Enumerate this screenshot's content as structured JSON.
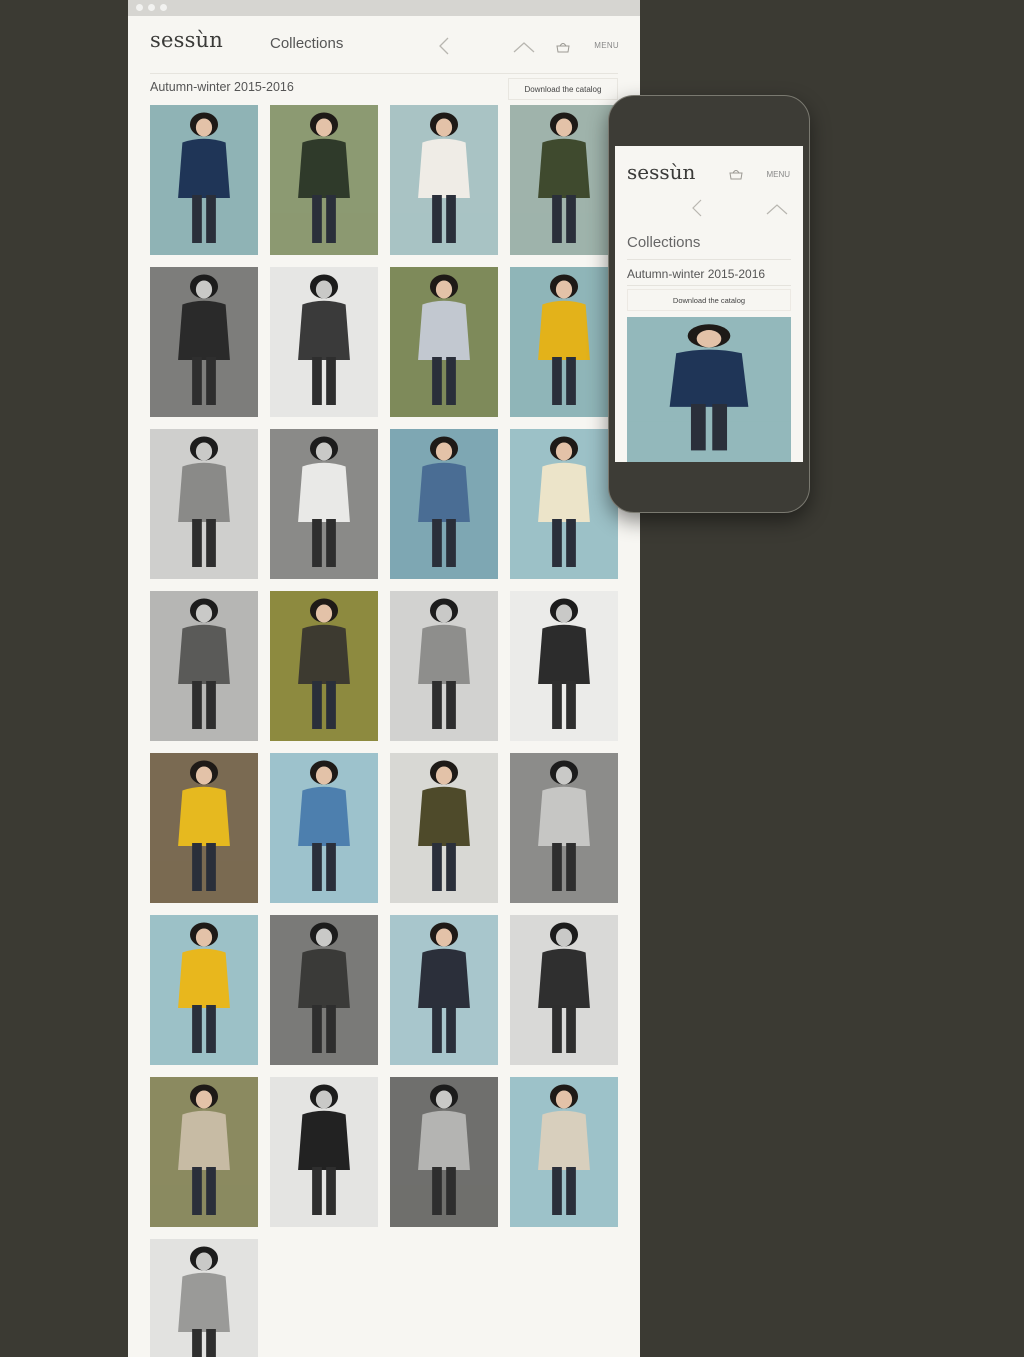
{
  "brand": "sessùn",
  "nav": {
    "title": "Collections",
    "menu_label": "MENU"
  },
  "collection": {
    "season": "Autumn-winter 2015-2016",
    "download_label": "Download the catalog"
  },
  "mobile": {
    "brand": "sessùn",
    "menu_label": "MENU",
    "title": "Collections",
    "season": "Autumn-winter 2015-2016",
    "download_label": "Download the catalog"
  },
  "photos": [
    {
      "bg": "#8fb3b5",
      "coat": "#1f3557",
      "tone": "color"
    },
    {
      "bg": "#8c9a72",
      "coat": "#2f3a2a",
      "tone": "color"
    },
    {
      "bg": "#a9c3c4",
      "coat": "#efece6",
      "tone": "color"
    },
    {
      "bg": "#9fb3ab",
      "coat": "#3f4a2e",
      "tone": "color"
    },
    {
      "bg": "#7d7d7b",
      "coat": "#2a2a2a",
      "tone": "bw"
    },
    {
      "bg": "#e6e6e4",
      "coat": "#3a3a3a",
      "tone": "bw"
    },
    {
      "bg": "#7e8a5a",
      "coat": "#c2c8d0",
      "tone": "color"
    },
    {
      "bg": "#8fb5b8",
      "coat": "#e3b21a",
      "tone": "color"
    },
    {
      "bg": "#cfcfcd",
      "coat": "#8a8a88",
      "tone": "bw"
    },
    {
      "bg": "#8a8a88",
      "coat": "#e9e9e7",
      "tone": "bw"
    },
    {
      "bg": "#7ea7b3",
      "coat": "#4a6d94",
      "tone": "color"
    },
    {
      "bg": "#9cc1c7",
      "coat": "#ece4c9",
      "tone": "color"
    },
    {
      "bg": "#b6b6b4",
      "coat": "#5a5a58",
      "tone": "bw"
    },
    {
      "bg": "#8d8a3f",
      "coat": "#3d3a30",
      "tone": "color"
    },
    {
      "bg": "#d2d2d0",
      "coat": "#8e8e8c",
      "tone": "bw"
    },
    {
      "bg": "#ebebe9",
      "coat": "#2c2c2c",
      "tone": "bw"
    },
    {
      "bg": "#7a6a52",
      "coat": "#e6b91f",
      "tone": "color"
    },
    {
      "bg": "#9dc2cc",
      "coat": "#4d7fae",
      "tone": "color"
    },
    {
      "bg": "#d8d8d4",
      "coat": "#4e4a2a",
      "tone": "color"
    },
    {
      "bg": "#8c8c8a",
      "coat": "#c6c6c4",
      "tone": "bw"
    },
    {
      "bg": "#9cc1c7",
      "coat": "#e8b71d",
      "tone": "color"
    },
    {
      "bg": "#7a7a78",
      "coat": "#3a3a38",
      "tone": "bw"
    },
    {
      "bg": "#a8c6cc",
      "coat": "#2b2f3a",
      "tone": "color"
    },
    {
      "bg": "#d9d9d7",
      "coat": "#2f2f2f",
      "tone": "bw"
    },
    {
      "bg": "#8b8a60",
      "coat": "#c7bba4",
      "tone": "color"
    },
    {
      "bg": "#e4e4e2",
      "coat": "#222222",
      "tone": "bw"
    },
    {
      "bg": "#6f6f6d",
      "coat": "#b4b4b2",
      "tone": "bw"
    },
    {
      "bg": "#9dc2c9",
      "coat": "#d8cfbd",
      "tone": "color"
    },
    {
      "bg": "#e2e2e0",
      "coat": "#9a9a98",
      "tone": "bw"
    }
  ],
  "mobile_photo": {
    "bg": "#93b8bb",
    "coat": "#1f3557"
  },
  "colors": {
    "page_bg": "#3b3a33",
    "panel_bg": "#f7f6f2",
    "phone_body": "#3d3c36"
  },
  "icons": [
    "back-chevron-icon",
    "up-chevron-icon",
    "cart-icon"
  ]
}
